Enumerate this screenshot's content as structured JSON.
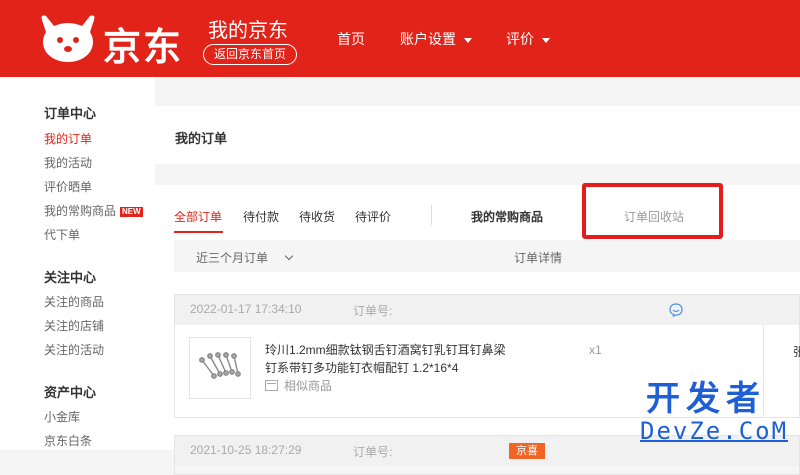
{
  "header": {
    "logo_text": "京东",
    "site_title": "我的京东",
    "back_home": "返回京东首页",
    "nav": [
      {
        "label": "首页"
      },
      {
        "label": "账户设置"
      },
      {
        "label": "评价"
      }
    ]
  },
  "sidebar": {
    "groups": [
      {
        "title": "订单中心",
        "items": [
          {
            "label": "我的订单"
          },
          {
            "label": "我的活动"
          },
          {
            "label": "评价晒单"
          },
          {
            "label": "我的常购商品",
            "badge": "NEW"
          },
          {
            "label": "代下单"
          }
        ]
      },
      {
        "title": "关注中心",
        "items": [
          {
            "label": "关注的商品"
          },
          {
            "label": "关注的店铺"
          },
          {
            "label": "关注的活动"
          }
        ]
      },
      {
        "title": "资产中心",
        "items": [
          {
            "label": "小金库"
          },
          {
            "label": "京东白条"
          }
        ]
      }
    ]
  },
  "main": {
    "page_title": "我的订单",
    "tabs": [
      {
        "label": "全部订单"
      },
      {
        "label": "待付款"
      },
      {
        "label": "待收货"
      },
      {
        "label": "待评价"
      }
    ],
    "frequent_tab": "我的常购商品",
    "recycle_tab": "订单回收站",
    "table_head": {
      "range": "近三个月订单",
      "detail": "订单详情"
    },
    "orders": [
      {
        "date": "2022-01-17 17:34:10",
        "number_label": "订单号:",
        "product_name": "玲川1.2mm细款钛钢舌钉酒窝钉乳钉耳钉鼻梁钉系带钉多功能钉衣帽配钉 1.2*16*4",
        "similar": "相似商品",
        "qty": "x1",
        "right_fragment": "张"
      },
      {
        "date": "2021-10-25 18:27:29",
        "number_label": "订单号:",
        "tag": "京喜"
      }
    ]
  },
  "watermark": {
    "cn": "开发者",
    "en": "DevZe.CoM"
  },
  "colors": {
    "brand_red": "#e2231a",
    "highlight": "#e61c1c",
    "watermark_blue": "#1e5fd6"
  }
}
